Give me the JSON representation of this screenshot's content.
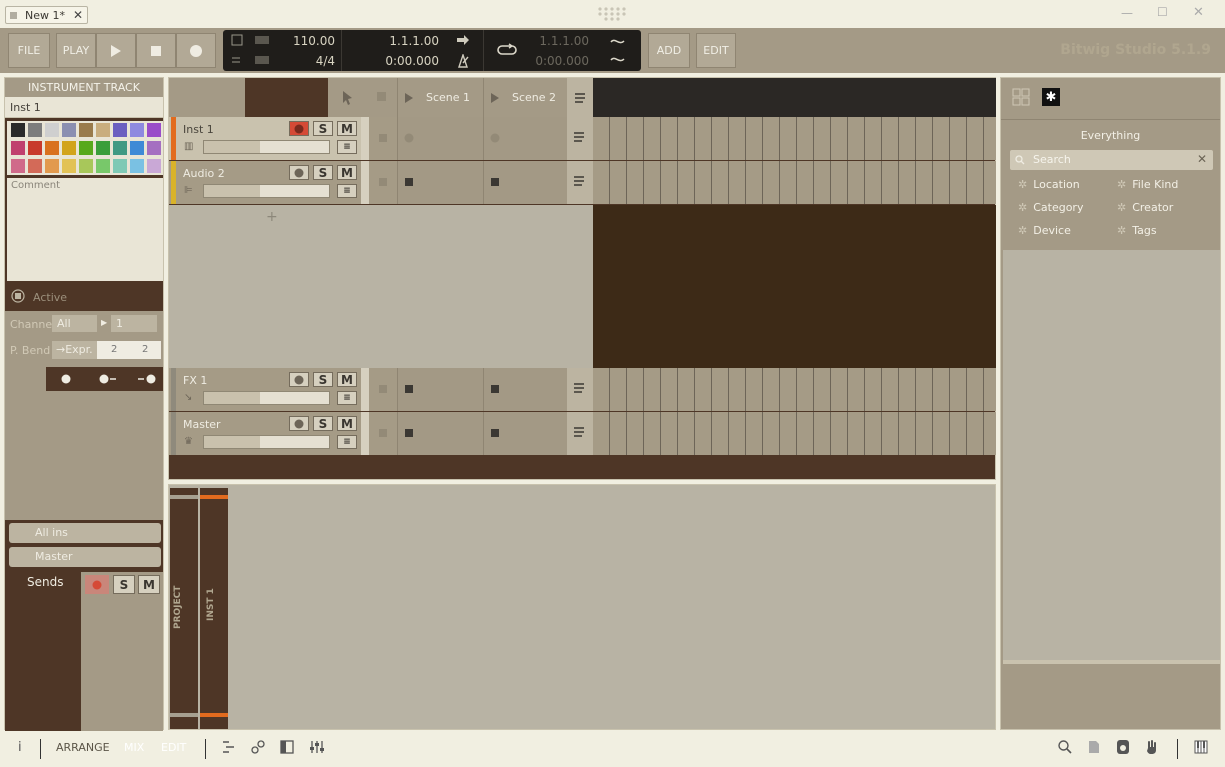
{
  "titlebar": {
    "tab_label": "New 1*",
    "close_glyph": "✕",
    "win_minimize": "—",
    "win_maximize": "☐",
    "win_close": "✕"
  },
  "toolbar": {
    "file_label": "FILE",
    "play_label": "PLAY",
    "add_label": "ADD",
    "edit_label": "EDIT",
    "brand": "Bitwig Studio 5.1.9"
  },
  "transport": {
    "tempo": "110.00",
    "time_signature": "4/4",
    "position_bars": "1.1.1.00",
    "position_time": "0:00.000",
    "loop_bars": "1.1.1.00",
    "loop_time": "0:00.000"
  },
  "inspector": {
    "header": "INSTRUMENT TRACK",
    "track_name": "Inst 1",
    "comment_label": "Comment",
    "active_label": "Active",
    "channel_label": "Channel",
    "channel_value": "All",
    "channel_num": "1",
    "pbend_label": "P. Bend",
    "expr_label": "→Expr.",
    "pbend_a": "2",
    "pbend_b": "2",
    "input_label": "All ins",
    "output_label": "Master",
    "sends_label": "Sends",
    "colors": [
      "#2a2a2a",
      "#7d7d7d",
      "#cfcfcf",
      "#8b8fb1",
      "#9a7b4c",
      "#c9ad7e",
      "#6b5fc0",
      "#8e8ae0",
      "#9a4dc9",
      "#c0406e",
      "#c83a2c",
      "#d9721e",
      "#d2a41c",
      "#58a91c",
      "#3a9e3a",
      "#409a84",
      "#3f8ad6",
      "#a56fc1",
      "#d06a8a",
      "#d36a58",
      "#e29a4e",
      "#e2c256",
      "#a8c75a",
      "#78c86a",
      "#7ec9b5",
      "#7ac1e3",
      "#c9a8d6"
    ]
  },
  "arranger": {
    "scenes": [
      "Scene 1",
      "Scene 2"
    ],
    "tracks": [
      {
        "name": "Inst 1",
        "accent": "#e26b1e"
      },
      {
        "name": "Audio 2",
        "accent": "#d9b32a"
      },
      {
        "name": "FX 1",
        "accent": "#8f8a7c"
      },
      {
        "name": "Master",
        "accent": "#8f8a7c"
      }
    ],
    "solo": "S",
    "mute": "M",
    "add_track": "+"
  },
  "mixer": {
    "project_label": "PROJECT",
    "inst_label": "INST 1"
  },
  "browser": {
    "title": "Everything",
    "search_placeholder": "Search",
    "filters": [
      "Location",
      "File Kind",
      "Category",
      "Creator",
      "Device",
      "Tags"
    ]
  },
  "bottombar": {
    "info": "i",
    "arrange": "ARRANGE",
    "mix": "MIX",
    "edit": "EDIT"
  },
  "colors": {
    "accent_orange": "#e26b1e",
    "panel_brown": "#4e3626",
    "toolbar_tan": "#a49a86"
  }
}
